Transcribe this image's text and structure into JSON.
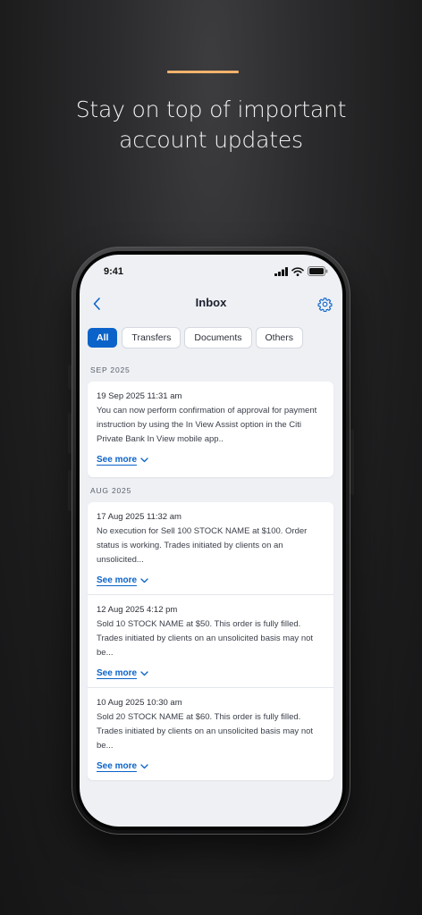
{
  "promo": {
    "headline_line1": "Stay on top of important",
    "headline_line2": "account updates",
    "accent_color": "#f2b26b"
  },
  "status_bar": {
    "time": "9:41"
  },
  "header": {
    "title": "Inbox",
    "back_icon": "chevron-left-icon",
    "settings_icon": "gear-icon"
  },
  "tabs": [
    {
      "label": "All",
      "active": true
    },
    {
      "label": "Transfers",
      "active": false
    },
    {
      "label": "Documents",
      "active": false
    },
    {
      "label": "Others",
      "active": false
    }
  ],
  "sections": [
    {
      "label": "SEP 2025",
      "messages": [
        {
          "date": "19 Sep 2025 11:31 am",
          "body": "You can now perform confirmation of approval for payment instruction by using the In View Assist option in the Citi Private Bank In View mobile app..",
          "see_more": "See more"
        }
      ]
    },
    {
      "label": "AUG 2025",
      "messages": [
        {
          "date": "17 Aug 2025 11:32 am",
          "body": "No execution for Sell 100 STOCK NAME at $100. Order status is working. Trades initiated by clients on an unsolicited...",
          "see_more": "See more"
        },
        {
          "date": "12 Aug 2025 4:12 pm",
          "body": "Sold 10 STOCK NAME at $50. This order is fully filled. Trades initiated by clients on an unsolicited basis may not be...",
          "see_more": "See more"
        },
        {
          "date": "10 Aug 2025 10:30 am",
          "body": "Sold 20 STOCK NAME at $60. This order is fully filled. Trades initiated by clients on an unsolicited basis may not be...",
          "see_more": "See more"
        }
      ]
    }
  ],
  "colors": {
    "primary": "#0b63c9",
    "screen_background": "#eef0f4"
  }
}
